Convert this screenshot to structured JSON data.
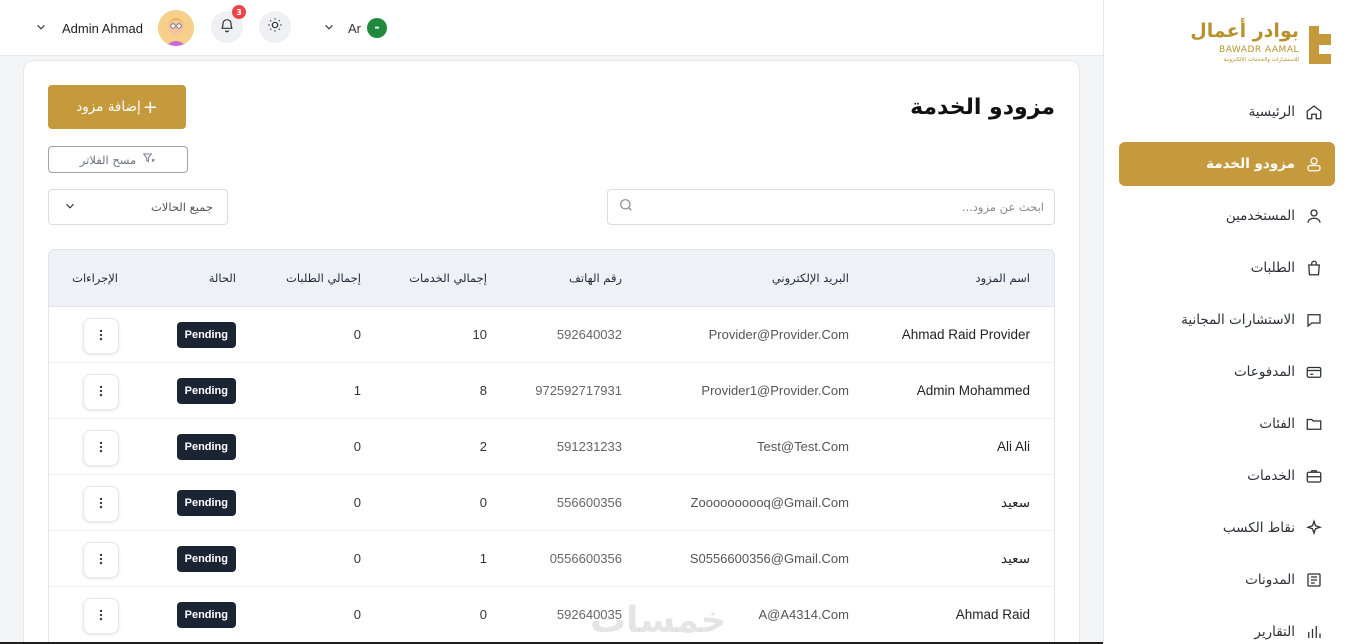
{
  "topbar": {
    "user_name": "Admin Ahmad",
    "notifications_count": "3",
    "language": "Ar"
  },
  "brand": {
    "name_ar": "بوادر أعمال",
    "name_en": "BAWADR AAMAL",
    "tagline": "للاستشارات والخدمات الإلكترونية",
    "color": "#c49a3c"
  },
  "sidebar": {
    "items": [
      {
        "label": "الرئيسية",
        "icon": "home-icon",
        "active": false
      },
      {
        "label": "مزودو الخدمة",
        "icon": "users-icon",
        "active": true
      },
      {
        "label": "المستخدمين",
        "icon": "user-icon",
        "active": false
      },
      {
        "label": "الطلبات",
        "icon": "bag-icon",
        "active": false
      },
      {
        "label": "الاستشارات المجانية",
        "icon": "chat-icon",
        "active": false
      },
      {
        "label": "المدفوعات",
        "icon": "card-icon",
        "active": false
      },
      {
        "label": "الفئات",
        "icon": "folder-icon",
        "active": false
      },
      {
        "label": "الخدمات",
        "icon": "briefcase-icon",
        "active": false
      },
      {
        "label": "نقاط الكسب",
        "icon": "sparkle-icon",
        "active": false
      },
      {
        "label": "المدونات",
        "icon": "newspaper-icon",
        "active": false
      },
      {
        "label": "التقارير",
        "icon": "chart-icon",
        "active": false
      }
    ]
  },
  "main": {
    "title": "مزودو الخدمة",
    "add_button": "إضافة مزود",
    "clear_filters": "مسح الفلاتر",
    "status_filter": "جميع الحالات",
    "search_placeholder": "ابحث عن مزود...",
    "table": {
      "headers": {
        "name": "اسم المزود",
        "email": "البريد الإلكتروني",
        "phone": "رقم الهاتف",
        "services": "إجمالي الخدمات",
        "orders": "إجمالي الطلبات",
        "status": "الحالة",
        "actions": "الإجراءات"
      },
      "rows": [
        {
          "name": "Ahmad Raid Provider",
          "email": "Provider@Provider.Com",
          "phone": "592640032",
          "services": "10",
          "orders": "0",
          "status": "Pending"
        },
        {
          "name": "Admin Mohammed",
          "email": "Provider1@Provider.Com",
          "phone": "972592717931",
          "services": "8",
          "orders": "1",
          "status": "Pending"
        },
        {
          "name": "Ali Ali",
          "email": "Test@Test.Com",
          "phone": "591231233",
          "services": "2",
          "orders": "0",
          "status": "Pending"
        },
        {
          "name": "سعيد",
          "email": "Zoooooooooq@Gmail.Com",
          "phone": "556600356",
          "services": "0",
          "orders": "0",
          "status": "Pending"
        },
        {
          "name": "سعيد",
          "email": "S0556600356@Gmail.Com",
          "phone": "0556600356",
          "services": "1",
          "orders": "0",
          "status": "Pending"
        },
        {
          "name": "Ahmad Raid",
          "email": "A@A4314.Com",
          "phone": "592640035",
          "services": "0",
          "orders": "0",
          "status": "Pending"
        }
      ]
    }
  },
  "watermark": "خمسات"
}
